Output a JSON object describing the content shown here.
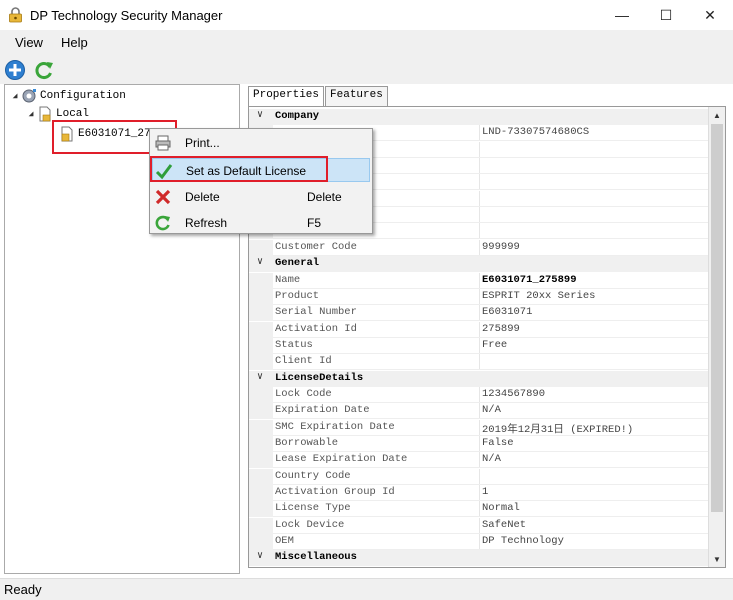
{
  "window": {
    "title": "DP Technology Security Manager",
    "minimize_glyph": "—",
    "maximize_glyph": "☐",
    "close_glyph": "✕"
  },
  "menu": {
    "items": [
      "View",
      "Help"
    ]
  },
  "toolbar": {
    "icons": [
      "add-icon",
      "refresh-icon"
    ]
  },
  "tree": {
    "root": "Configuration",
    "child": "Local",
    "leaf": "E6031071_275899"
  },
  "tabs": [
    "Properties",
    "Features"
  ],
  "grid": {
    "rows": [
      {
        "type": "cat",
        "title": "Company"
      },
      {
        "type": "row",
        "key": "",
        "value": "LND-73307574680CS"
      },
      {
        "type": "row",
        "key": "",
        "value": ""
      },
      {
        "type": "row",
        "key": "",
        "value": ""
      },
      {
        "type": "row",
        "key": "",
        "value": ""
      },
      {
        "type": "row",
        "key": "",
        "value": ""
      },
      {
        "type": "row",
        "key": "",
        "value": ""
      },
      {
        "type": "row",
        "key": "",
        "value": ""
      },
      {
        "type": "row",
        "key": "Customer Code",
        "value": "999999"
      },
      {
        "type": "cat",
        "title": "General"
      },
      {
        "type": "row",
        "key": "Name",
        "value": "E6031071_275899",
        "bold": true
      },
      {
        "type": "row",
        "key": "Product",
        "value": "ESPRIT 20xx Series"
      },
      {
        "type": "row",
        "key": "Serial Number",
        "value": "E6031071"
      },
      {
        "type": "row",
        "key": "Activation Id",
        "value": "275899"
      },
      {
        "type": "row",
        "key": "Status",
        "value": "Free"
      },
      {
        "type": "row",
        "key": "Client Id",
        "value": ""
      },
      {
        "type": "cat",
        "title": "LicenseDetails"
      },
      {
        "type": "row",
        "key": "Lock Code",
        "value": "1234567890"
      },
      {
        "type": "row",
        "key": "Expiration Date",
        "value": "N/A"
      },
      {
        "type": "row",
        "key": "SMC Expiration Date",
        "value": "2019年12月31日 (EXPIRED!)"
      },
      {
        "type": "row",
        "key": "Borrowable",
        "value": "False"
      },
      {
        "type": "row",
        "key": "Lease Expiration Date",
        "value": "N/A"
      },
      {
        "type": "row",
        "key": "Country Code",
        "value": ""
      },
      {
        "type": "row",
        "key": "Activation Group Id",
        "value": "1"
      },
      {
        "type": "row",
        "key": "License Type",
        "value": "Normal"
      },
      {
        "type": "row",
        "key": "Lock Device",
        "value": "SafeNet"
      },
      {
        "type": "row",
        "key": "OEM",
        "value": "DP Technology"
      },
      {
        "type": "cat",
        "title": "Miscellaneous"
      }
    ]
  },
  "context_menu": {
    "items": [
      {
        "label": "Print...",
        "shortcut": "",
        "icon": "printer-icon"
      },
      {
        "label": "Set as Default License",
        "shortcut": "",
        "icon": "checkmark-icon"
      },
      {
        "label": "Delete",
        "shortcut": "Delete",
        "icon": "red-x-icon"
      },
      {
        "label": "Refresh",
        "shortcut": "F5",
        "icon": "refresh-icon"
      }
    ]
  },
  "status": {
    "text": "Ready"
  },
  "colors": {
    "highlight_border": "#e01e2a",
    "menu_highlight": "#cce4f7"
  }
}
